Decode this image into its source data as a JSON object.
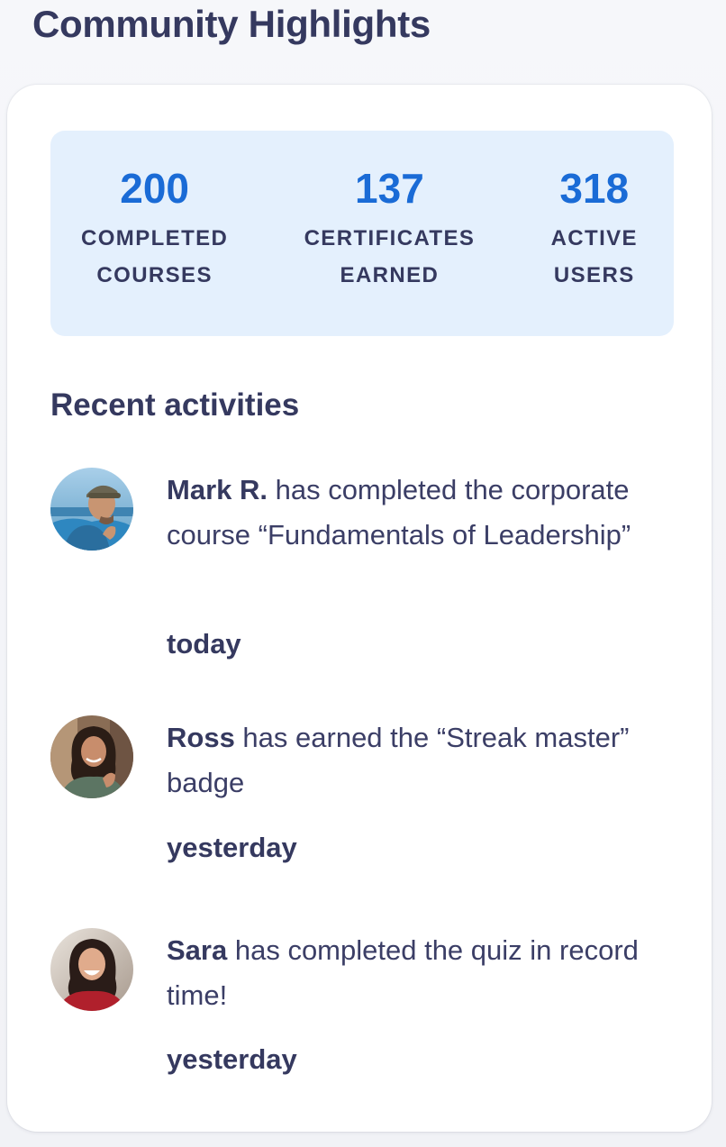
{
  "page": {
    "title": "Community Highlights"
  },
  "stats": [
    {
      "value": "200",
      "label": "COMPLETED\nCOURSES"
    },
    {
      "value": "137",
      "label": "CERTIFICATES\nEARNED"
    },
    {
      "value": "318",
      "label": "ACTIVE\nUSERS"
    }
  ],
  "recent": {
    "title": "Recent activities",
    "items": [
      {
        "name": "Mark R.",
        "text": " has completed the corporate course “Fundamentals of Leadership”",
        "time": "today",
        "avatar": "avatar-mark-photo"
      },
      {
        "name": "Ross",
        "text": " has earned the “Streak master” badge",
        "time": "yesterday",
        "avatar": "avatar-ross-photo"
      },
      {
        "name": "Sara",
        "text": " has completed the quiz in record time!",
        "time": "yesterday",
        "avatar": "avatar-sara-photo"
      }
    ]
  },
  "colors": {
    "accent": "#1a6bd6",
    "text_dark": "#35395f",
    "stats_background": "#e4f0fd",
    "card_background": "#ffffff"
  }
}
